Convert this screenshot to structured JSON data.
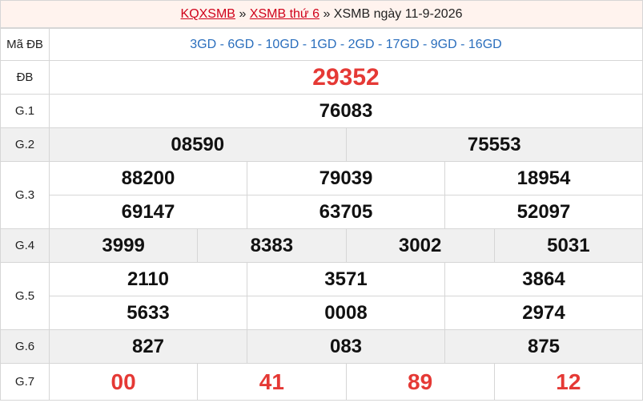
{
  "breadcrumb": {
    "item1": "KQXSMB",
    "sep1": "»",
    "item2": "XSMB thứ 6",
    "sep2": "»",
    "item3": "XSMB ngày 11-9-2026"
  },
  "labels": {
    "ma_db": "Mã ĐB",
    "db": "ĐB",
    "g1": "G.1",
    "g2": "G.2",
    "g3": "G.3",
    "g4": "G.4",
    "g5": "G.5",
    "g6": "G.6",
    "g7": "G.7"
  },
  "ma_db_codes": "3GD - 6GD - 10GD - 1GD - 2GD - 17GD - 9GD - 16GD",
  "db": "29352",
  "g1": "76083",
  "g2": [
    "08590",
    "75553"
  ],
  "g3": [
    "88200",
    "79039",
    "18954",
    "69147",
    "63705",
    "52097"
  ],
  "g4": [
    "3999",
    "8383",
    "3002",
    "5031"
  ],
  "g5": [
    "2110",
    "3571",
    "3864",
    "5633",
    "0008",
    "2974"
  ],
  "g6": [
    "827",
    "083",
    "875"
  ],
  "g7": [
    "00",
    "41",
    "89",
    "12"
  ],
  "colors": {
    "accent_red": "#e53935",
    "link_red": "#d0021b",
    "code_blue": "#2a6ebd",
    "header_bg": "#fff3ee",
    "alt_row_bg": "#f0f0f0"
  }
}
